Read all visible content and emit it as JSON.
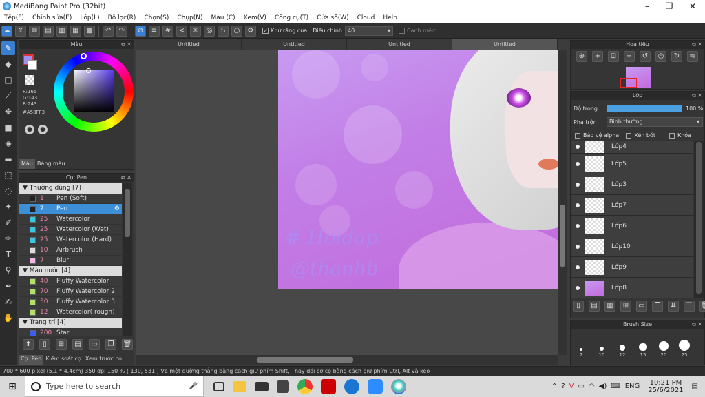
{
  "window": {
    "title": "MediBang Paint Pro (32bit)"
  },
  "menu": [
    "Tệp(F)",
    "Chỉnh sửa(E)",
    "Lớp(L)",
    "Bộ lọc(R)",
    "Chọn(S)",
    "Chụp(N)",
    "Màu (C)",
    "Xem(V)",
    "Công cụ(T)",
    "Cửa sổ(W)",
    "Cloud",
    "Help"
  ],
  "toolbar": {
    "antialias": "Khử răng cưa",
    "adjust_label": "Điều chỉnh",
    "adjust_value": "40",
    "smooth": "Canh mềm"
  },
  "color_panel": {
    "title": "Màu",
    "r": "R:165",
    "g": "G:143",
    "b": "B:243",
    "hex": "#A58FF3",
    "tab1": "Màu",
    "tab2": "Bảng màu",
    "fg": "#A58FF3"
  },
  "brush_panel": {
    "title": "Cọ: Pen",
    "groups": [
      {
        "name": "Thường dùng [7]",
        "items": [
          {
            "size": "1",
            "name": "Pen (Soft)",
            "color": "#222222"
          },
          {
            "size": "2",
            "name": "Pen",
            "color": "#222222",
            "selected": true
          },
          {
            "size": "25",
            "name": "Watercolor",
            "color": "#3ec6e0"
          },
          {
            "size": "25",
            "name": "Watercolor (Wet)",
            "color": "#3ec6e0"
          },
          {
            "size": "25",
            "name": "Watercolor (Hard)",
            "color": "#3ec6e0"
          },
          {
            "size": "10",
            "name": "Airbrush",
            "color": "#dddddd"
          },
          {
            "size": "7",
            "name": "Blur",
            "color": "#f7b6e8"
          }
        ]
      },
      {
        "name": "Màu nước [4]",
        "items": [
          {
            "size": "40",
            "name": "Fluffy Watercolor",
            "color": "#b4e06a"
          },
          {
            "size": "70",
            "name": "Fluffy Watercolor 2",
            "color": "#b4e06a"
          },
          {
            "size": "50",
            "name": "Fluffy Watercolor 3",
            "color": "#b4e06a"
          },
          {
            "size": "12",
            "name": "Watercolor( rough)",
            "color": "#b4e06a"
          }
        ]
      },
      {
        "name": "Trang trí [4]",
        "items": [
          {
            "size": "200",
            "name": "Star",
            "color": "#3a5ee8"
          }
        ]
      }
    ],
    "bottom_tabs": [
      "Cọ: Pen",
      "Kiểm soát cọ",
      "Xem trước cọ"
    ]
  },
  "tabs": [
    "Untitled",
    "Untitled",
    "Untitled",
    "Untitled"
  ],
  "canvas": {
    "watermark1": "# Hoidap",
    "watermark2": "@thanhb"
  },
  "navigator": {
    "title": "Hoa tiêu"
  },
  "layers": {
    "title": "Lớp",
    "opacity_label": "Độ trong",
    "opacity_value": "100 %",
    "opacity": 1.0,
    "blend_label": "Pha trộn",
    "blend_value": "Bình thường",
    "protect_alpha": "Bảo vệ alpha",
    "clip": "Xén bớt",
    "lock": "Khóa",
    "items": [
      "Lớp4",
      "Lớp5",
      "Lớp3",
      "Lớp7",
      "Lớp6",
      "Lớp10",
      "Lớp9",
      "Lớp8"
    ]
  },
  "brush_size": {
    "title": "Brush Size",
    "sizes": [
      "7",
      "10",
      "12",
      "15",
      "20",
      "25"
    ]
  },
  "status": {
    "text": "700 * 600 pixel  (5.1 * 4.4cm)  350 dpi  150 %  ( 130, 531 )  Vẽ một đường thẳng bằng cách giữ phím Shift, Thay đổi cỡ cọ bằng cách giữ phím Ctrl, Alt và kéo"
  },
  "taskbar": {
    "search": "Type here to search",
    "lang": "ENG",
    "time": "10:21 PM",
    "date": "25/6/2021"
  }
}
